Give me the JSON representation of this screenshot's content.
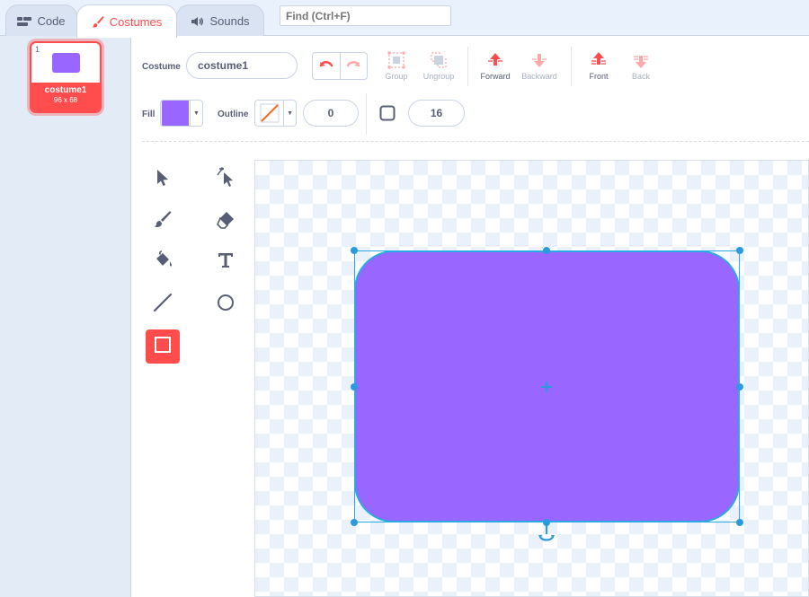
{
  "tabs": [
    {
      "label": "Code",
      "icon": "code-icon"
    },
    {
      "label": "Costumes",
      "icon": "brush-icon",
      "active": true
    },
    {
      "label": "Sounds",
      "icon": "speaker-icon"
    }
  ],
  "find": {
    "placeholder": "Find (Ctrl+F)"
  },
  "costume_list": [
    {
      "index": "1",
      "name": "costume1",
      "size": "96 x 68",
      "selected": true
    }
  ],
  "toolbar": {
    "costume_label": "Costume",
    "costume_name": "costume1",
    "group": "Group",
    "ungroup": "Ungroup",
    "forward": "Forward",
    "backward": "Backward",
    "front": "Front",
    "back": "Back",
    "fill_label": "Fill",
    "fill_color": "#9966ff",
    "outline_label": "Outline",
    "outline_width": "0",
    "corner_radius": "16"
  },
  "tools": [
    "select",
    "reshape",
    "brush",
    "eraser",
    "fill",
    "text",
    "line",
    "circle",
    "rectangle"
  ],
  "active_tool": "rectangle",
  "colors": {
    "accent": "#ff4c4c",
    "shape_fill": "#9966ff",
    "selection": "#2baae1"
  }
}
